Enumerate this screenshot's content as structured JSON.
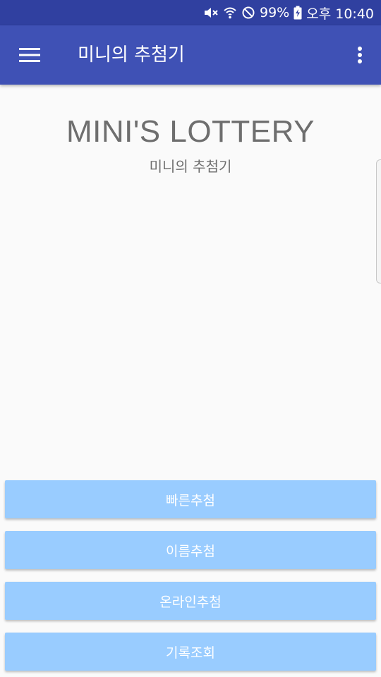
{
  "status_bar": {
    "battery_text": "99%",
    "time_text": "오후 10:40",
    "icons": [
      "mute-icon",
      "wifi-icon",
      "block-icon",
      "battery-charging-icon"
    ]
  },
  "app_bar": {
    "title": "미니의 추첨기",
    "icons": [
      "hamburger-menu-icon",
      "overflow-menu-icon"
    ]
  },
  "main": {
    "title": "MINI'S LOTTERY",
    "subtitle": "미니의 추첨기"
  },
  "buttons": {
    "quick_draw": "빠른추첨",
    "name_draw": "이름추첨",
    "online_draw": "온라인추첨",
    "history": "기록조회"
  },
  "colors": {
    "status_bar": "#3040a0",
    "app_bar": "#3f51b5",
    "button_bg": "#99ccff",
    "text_gray": "#6e6e6e",
    "background": "#fafafa"
  }
}
